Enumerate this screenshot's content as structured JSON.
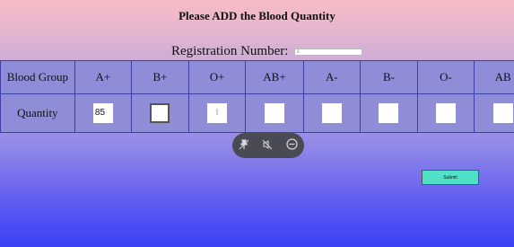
{
  "form": {
    "heading": "Please ADD the Blood Quantity",
    "registration_label": "Registration Number:",
    "registration_placeholder": "g"
  },
  "table": {
    "row1_header": "Blood Group",
    "row2_header": "Quantity",
    "groups": [
      "A+",
      "B+",
      "O+",
      "AB+",
      "A-",
      "B-",
      "O-",
      "AB"
    ],
    "quantities": [
      "85",
      "",
      "I",
      "",
      "",
      "",
      "",
      ""
    ]
  },
  "toolbar": {
    "icons": [
      "pin-off-icon",
      "mute-icon",
      "minus-circle-icon"
    ]
  },
  "submit": {
    "label": "Submit"
  }
}
